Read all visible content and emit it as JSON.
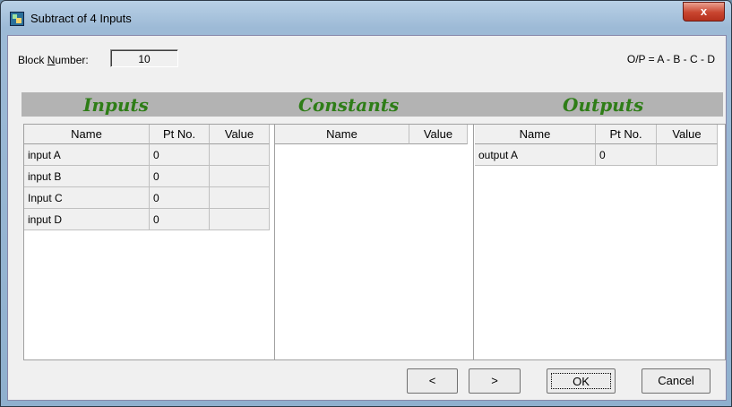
{
  "window": {
    "title": "Subtract of 4 Inputs",
    "close_label": "x"
  },
  "block": {
    "label_prefix": "Block ",
    "label_underlined": "N",
    "label_suffix": "umber:",
    "value": "10"
  },
  "formula": "O/P = A - B - C - D",
  "sections": {
    "inputs": "Inputs",
    "constants": "Constants",
    "outputs": "Outputs"
  },
  "inputs": {
    "headers": [
      "Name",
      "Pt No.",
      "Value"
    ],
    "rows": [
      {
        "name": "input A",
        "pt": "0",
        "value": ""
      },
      {
        "name": "input B",
        "pt": "0",
        "value": ""
      },
      {
        "name": "Input C",
        "pt": "0",
        "value": ""
      },
      {
        "name": "input D",
        "pt": "0",
        "value": ""
      }
    ]
  },
  "constants": {
    "headers": [
      "Name",
      "Value"
    ]
  },
  "outputs": {
    "headers": [
      "Name",
      "Pt No.",
      "Value"
    ],
    "rows": [
      {
        "name": "output A",
        "pt": "0",
        "value": ""
      }
    ]
  },
  "buttons": {
    "prev": "<",
    "next": ">",
    "ok": "OK",
    "cancel": "Cancel"
  }
}
